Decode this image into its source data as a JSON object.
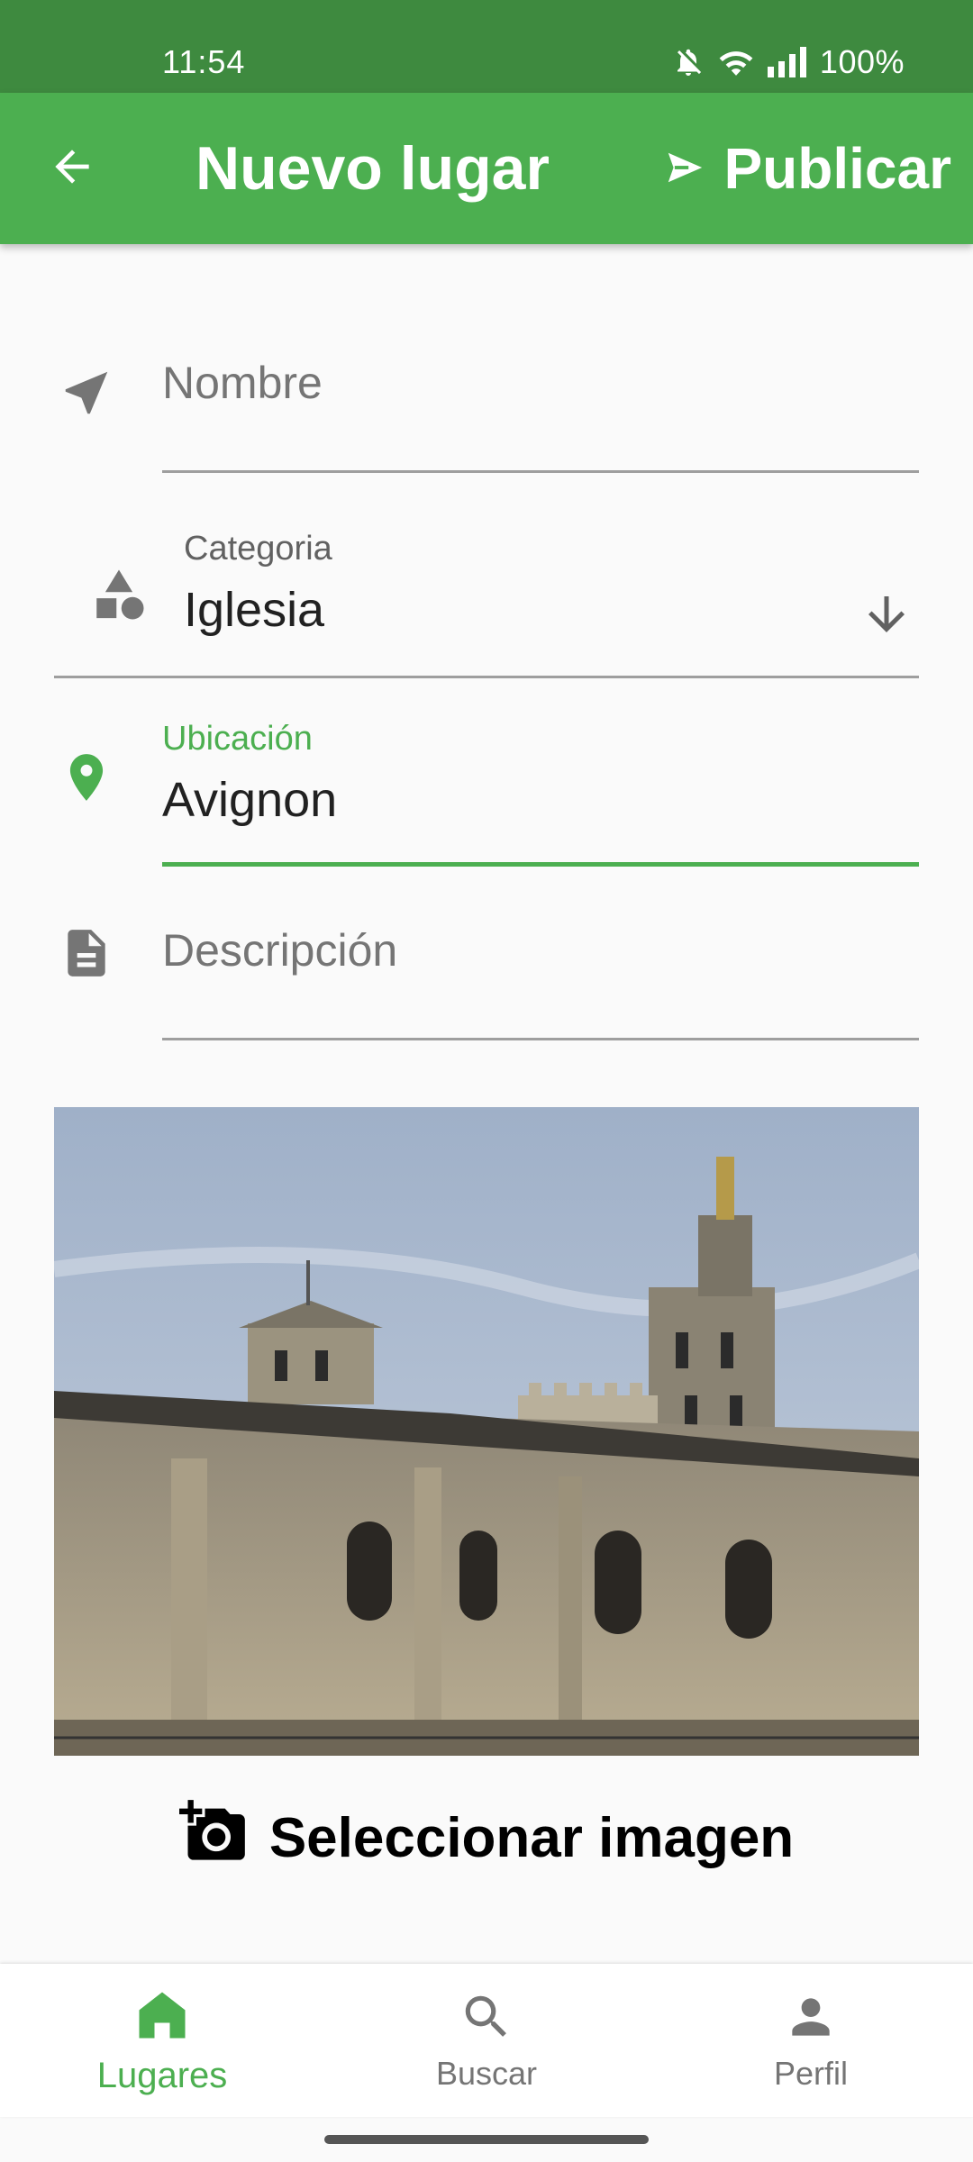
{
  "status_bar": {
    "time": "11:54",
    "battery": "100%"
  },
  "app_bar": {
    "title": "Nuevo lugar",
    "publish_label": "Publicar"
  },
  "form": {
    "name": {
      "placeholder": "Nombre",
      "value": ""
    },
    "category": {
      "label": "Categoria",
      "value": "Iglesia"
    },
    "location": {
      "label": "Ubicación",
      "value": "Avignon"
    },
    "description": {
      "placeholder": "Descripción",
      "value": ""
    }
  },
  "select_image_label": "Seleccionar imagen",
  "bottom_nav": {
    "items": [
      {
        "label": "Lugares",
        "icon": "home-icon",
        "active": true
      },
      {
        "label": "Buscar",
        "icon": "search-icon",
        "active": false
      },
      {
        "label": "Perfil",
        "icon": "person-icon",
        "active": false
      }
    ]
  },
  "colors": {
    "primary": "#4caf50",
    "status_bar": "#3e8a3f",
    "background": "#fafafa"
  }
}
